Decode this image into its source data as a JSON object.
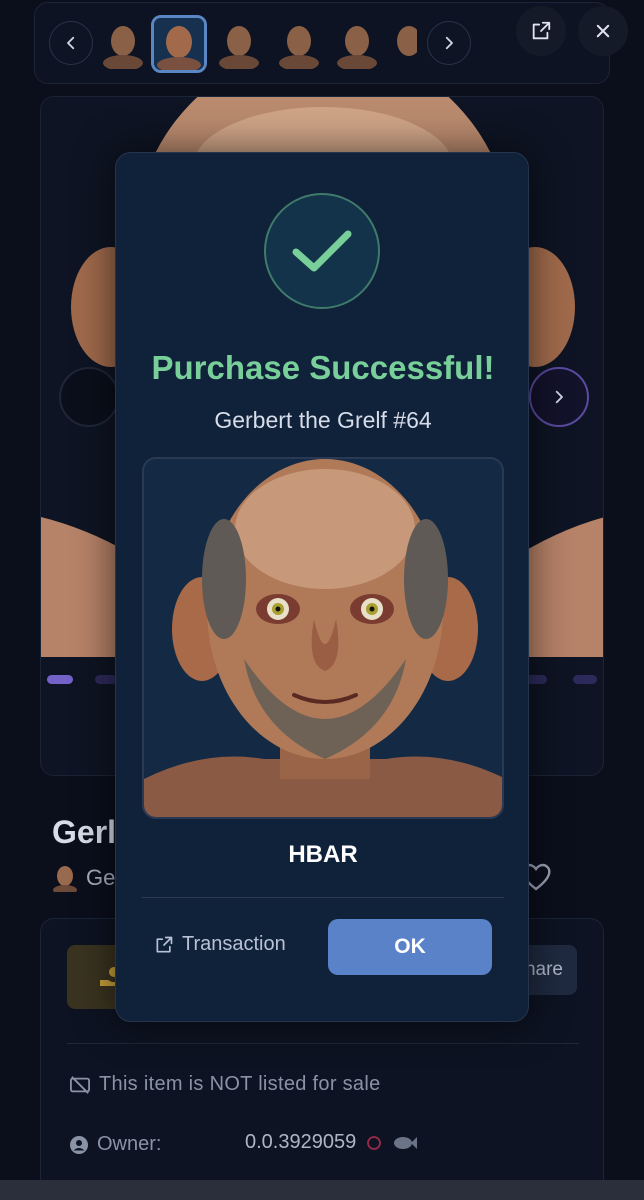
{
  "modal": {
    "title": "Purchase Successful!",
    "nft_name": "Gerbert the Grelf #64",
    "price_currency": "HBAR",
    "transaction_label": "Transaction",
    "ok_label": "OK"
  },
  "background": {
    "title_partial": "Gerl",
    "creator_partial": "Ge",
    "share_partial": "hare",
    "not_listed": "This item is NOT listed for sale",
    "owner_label": "Owner:",
    "owner_value": "0.0.3929059"
  },
  "colors": {
    "success_green": "#79cf9a",
    "ok_button": "#5a82c8",
    "modal_bg": "#10213a"
  },
  "icons": {
    "thumb_prev": "chevron-left-icon",
    "thumb_next": "chevron-right-icon",
    "open_external": "external-link-icon",
    "close": "close-icon",
    "check": "check-icon",
    "heart": "heart-icon",
    "offer": "hand-money-icon",
    "not_listed": "no-sale-icon",
    "owner": "user-icon"
  }
}
